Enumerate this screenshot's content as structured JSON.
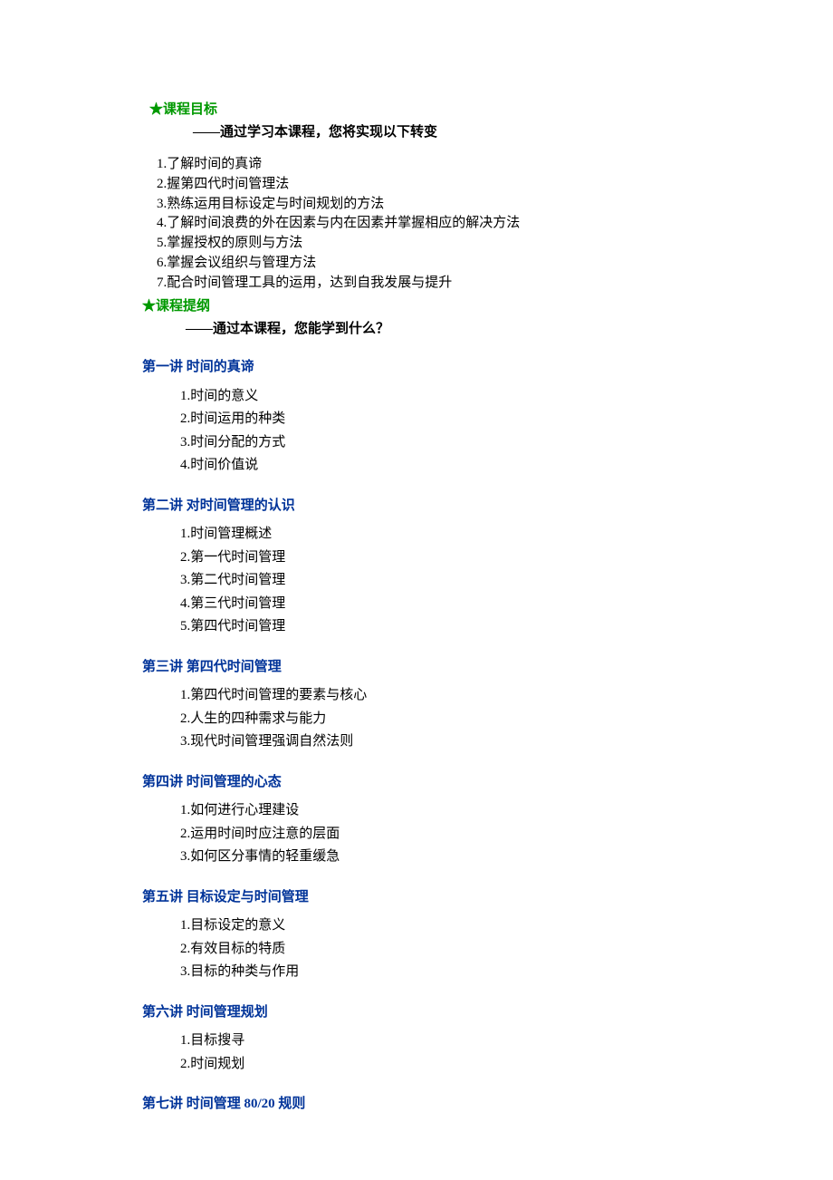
{
  "star": "★",
  "section1": {
    "title": "课程目标",
    "subtitle": "——通过学习本课程，您将实现以下转变",
    "items": [
      "1.了解时间的真谛",
      "2.握第四代时间管理法",
      "3.熟练运用目标设定与时间规划的方法",
      "4.了解时间浪费的外在因素与内在因素并掌握相应的解决方法",
      "5.掌握授权的原则与方法",
      "6.掌握会议组织与管理方法",
      "7.配合时间管理工具的运用，达到自我发展与提升"
    ]
  },
  "section2": {
    "title": "课程提纲",
    "subtitle": "——通过本课程，您能学到什么？",
    "lectures": [
      {
        "title": "第一讲  时间的真谛",
        "items": [
          "1.时间的意义",
          "2.时间运用的种类",
          "3.时间分配的方式",
          "4.时间价值说"
        ]
      },
      {
        "title": "第二讲  对时间管理的认识",
        "items": [
          "1.时间管理概述",
          "2.第一代时间管理",
          "3.第二代时间管理",
          "4.第三代时间管理",
          "5.第四代时间管理"
        ]
      },
      {
        "title": "第三讲  第四代时间管理",
        "items": [
          "1.第四代时间管理的要素与核心",
          "2.人生的四种需求与能力",
          "3.现代时间管理强调自然法则"
        ]
      },
      {
        "title": "第四讲  时间管理的心态",
        "items": [
          "1.如何进行心理建设",
          "2.运用时间时应注意的层面",
          "3.如何区分事情的轻重缓急"
        ]
      },
      {
        "title": "第五讲  目标设定与时间管理",
        "items": [
          "1.目标设定的意义",
          "2.有效目标的特质",
          "3.目标的种类与作用"
        ]
      },
      {
        "title": "第六讲   时间管理规划",
        "items": [
          "1.目标搜寻",
          "2.时间规划"
        ]
      },
      {
        "title": "第七讲  时间管理 80/20 规则",
        "items": []
      }
    ]
  }
}
